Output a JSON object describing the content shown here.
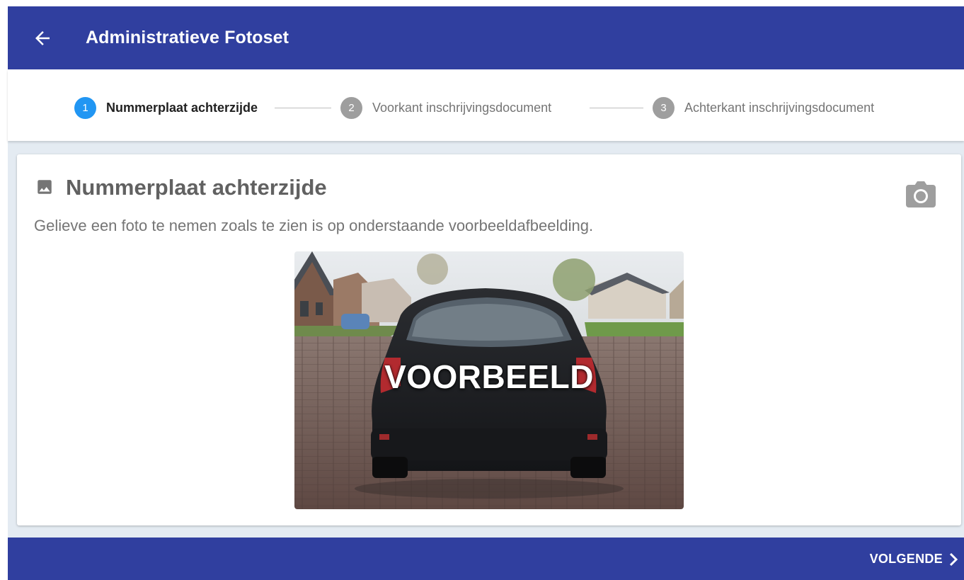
{
  "appbar": {
    "title": "Administratieve Fotoset",
    "back_icon": "arrow-left-icon"
  },
  "stepper": {
    "steps": [
      {
        "number": "1",
        "label": "Nummerplaat achterzijde",
        "state": "active"
      },
      {
        "number": "2",
        "label": "Voorkant inschrijvingsdocument",
        "state": "inactive"
      },
      {
        "number": "3",
        "label": "Achterkant inschrijvingsdocument",
        "state": "inactive"
      }
    ]
  },
  "card": {
    "icon": "image-icon",
    "title": "Nummerplaat achterzijde",
    "description": "Gelieve een foto te nemen zoals te zien is op onderstaande voorbeeldafbeelding.",
    "camera_icon": "camera-icon",
    "example_watermark": "VOORBEELD"
  },
  "footer": {
    "next_label": "VOLGENDE",
    "next_icon": "chevron-right-icon"
  },
  "colors": {
    "primary": "#303f9f",
    "step_active": "#2196f3",
    "step_inactive": "#9e9e9e",
    "background": "#e4ebf2"
  }
}
